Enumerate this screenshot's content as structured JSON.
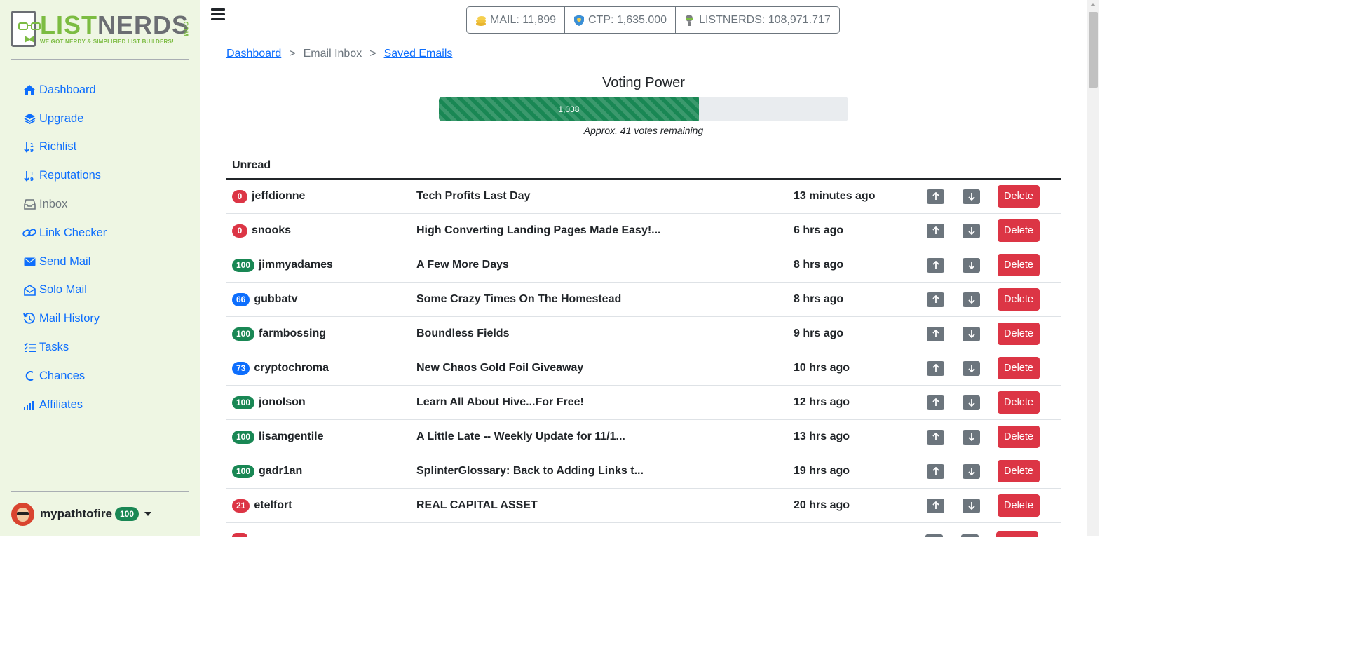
{
  "logo": {
    "word_part1": "LIST",
    "word_part2": "NERDS",
    "tagline": "WE GOT NERDY & SIMPLIFIED LIST BUILDERS!",
    "suffix": ".COM"
  },
  "sidebar": {
    "items": [
      {
        "label": "Dashboard",
        "icon": "home-icon",
        "active": false
      },
      {
        "label": "Upgrade",
        "icon": "layers-icon",
        "active": false
      },
      {
        "label": "Richlist",
        "icon": "sort-numeric-icon",
        "active": false
      },
      {
        "label": "Reputations",
        "icon": "sort-numeric-icon",
        "active": false
      },
      {
        "label": "Inbox",
        "icon": "inbox-icon",
        "active": true
      },
      {
        "label": "Link Checker",
        "icon": "link-icon",
        "active": false
      },
      {
        "label": "Send Mail",
        "icon": "envelope-icon",
        "active": false
      },
      {
        "label": "Solo Mail",
        "icon": "envelope-open-icon",
        "active": false
      },
      {
        "label": "Mail History",
        "icon": "history-icon",
        "active": false
      },
      {
        "label": "Tasks",
        "icon": "tasks-icon",
        "active": false
      },
      {
        "label": "Chances",
        "icon": "chances-icon",
        "active": false
      },
      {
        "label": "Affiliates",
        "icon": "signal-icon",
        "active": false
      }
    ]
  },
  "user": {
    "name": "mypathtofire",
    "reputation": "100"
  },
  "stats": {
    "mail": "MAIL: 11,899",
    "ctp": "CTP: 1,635.000",
    "listnerds": "LISTNERDS: 108,971.717"
  },
  "breadcrumb": {
    "dashboard": "Dashboard",
    "sep1": ">",
    "inbox": "Email Inbox",
    "sep2": ">",
    "saved": "Saved Emails"
  },
  "voting": {
    "title": "Voting Power",
    "value_label": "1,038",
    "fill_fraction": 0.635,
    "note": "Approx. 41 votes remaining"
  },
  "table": {
    "header": "Unread",
    "delete_label": "Delete",
    "rows": [
      {
        "rep": "0",
        "rep_color": "#dc3545",
        "user": "jeffdionne",
        "subject": "Tech Profits Last Day",
        "time": "13 minutes ago"
      },
      {
        "rep": "0",
        "rep_color": "#dc3545",
        "user": "snooks",
        "subject": "High Converting Landing Pages Made Easy!...",
        "time": "6 hrs ago"
      },
      {
        "rep": "100",
        "rep_color": "#198754",
        "user": "jimmyadames",
        "subject": "A Few More Days",
        "time": "8 hrs ago"
      },
      {
        "rep": "66",
        "rep_color": "#0d6efd",
        "user": "gubbatv",
        "subject": "Some Crazy Times On The Homestead",
        "time": "8 hrs ago"
      },
      {
        "rep": "100",
        "rep_color": "#198754",
        "user": "farmbossing",
        "subject": "Boundless Fields",
        "time": "9 hrs ago"
      },
      {
        "rep": "73",
        "rep_color": "#0d6efd",
        "user": "cryptochroma",
        "subject": "New Chaos Gold Foil Giveaway",
        "time": "10 hrs ago"
      },
      {
        "rep": "100",
        "rep_color": "#198754",
        "user": "jonolson",
        "subject": "Learn All About Hive...For Free!",
        "time": "12 hrs ago"
      },
      {
        "rep": "100",
        "rep_color": "#198754",
        "user": "lisamgentile",
        "subject": "A Little Late -- Weekly Update for 11/1...",
        "time": "13 hrs ago"
      },
      {
        "rep": "100",
        "rep_color": "#198754",
        "user": "gadr1an",
        "subject": "SplinterGlossary: Back to Adding Links t...",
        "time": "19 hrs ago"
      },
      {
        "rep": "21",
        "rep_color": "#dc3545",
        "user": "etelfort",
        "subject": "REAL CAPITAL ASSET",
        "time": "20 hrs ago"
      }
    ]
  }
}
